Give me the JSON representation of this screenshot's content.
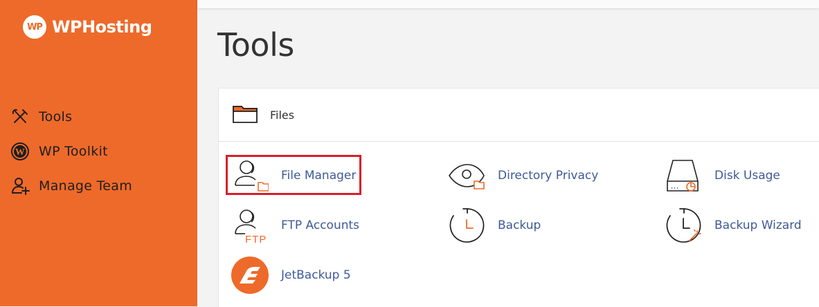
{
  "brand": {
    "badge": "WP",
    "name": "WPHosting"
  },
  "sidebar": {
    "items": [
      {
        "label": "Tools",
        "icon": "tools-icon"
      },
      {
        "label": "WP Toolkit",
        "icon": "wordpress-icon"
      },
      {
        "label": "Manage Team",
        "icon": "add-user-icon"
      }
    ]
  },
  "page": {
    "title": "Tools"
  },
  "files_section": {
    "title": "Files",
    "tools": [
      {
        "label": "File Manager",
        "icon": "user-folder-icon",
        "highlighted": true
      },
      {
        "label": "Directory Privacy",
        "icon": "eye-folder-icon"
      },
      {
        "label": "Disk Usage",
        "icon": "disk-usage-icon"
      },
      {
        "label": "FTP Accounts",
        "icon": "ftp-user-icon"
      },
      {
        "label": "Backup",
        "icon": "backup-clock-icon"
      },
      {
        "label": "Backup Wizard",
        "icon": "backup-wizard-icon"
      },
      {
        "label": "JetBackup 5",
        "icon": "jetbackup-logo-icon"
      }
    ]
  },
  "colors": {
    "sidebar": "#ee6a2a",
    "link": "#3d5a96",
    "highlight": "#d81e2a",
    "accent": "#ee6a2a"
  }
}
